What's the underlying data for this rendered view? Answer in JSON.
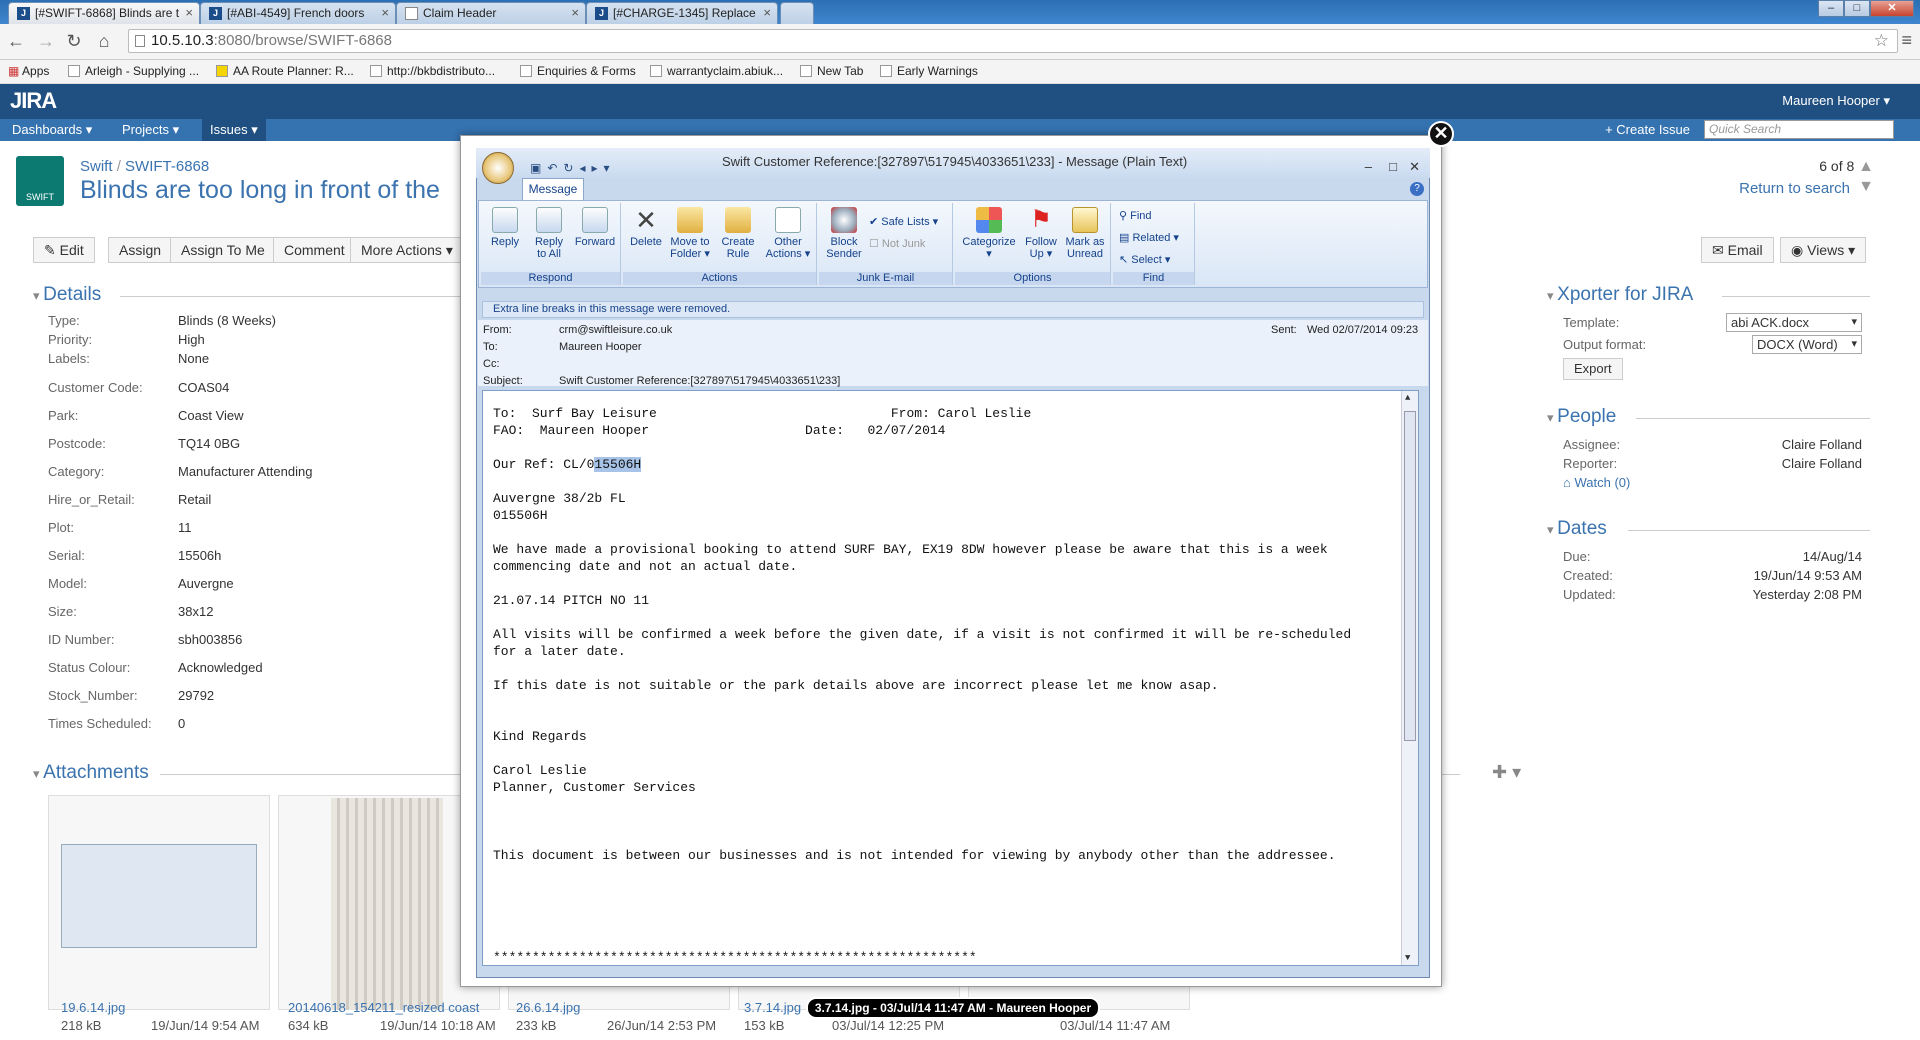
{
  "browser": {
    "tabs": [
      "[#SWIFT-6868] Blinds are t",
      "[#ABI-4549] French doors",
      "Claim Header",
      "[#CHARGE-1345] Replace"
    ],
    "url_host": "10.5.10.3",
    "url_path": ":8080/browse/SWIFT-6868",
    "bookmarks": [
      "Apps",
      "Arleigh - Supplying ...",
      "AA Route Planner: R...",
      "http://bkbdistributo...",
      "Enquiries & Forms",
      "warrantyclaim.abiuk...",
      "New Tab",
      "Early Warnings"
    ]
  },
  "jira": {
    "logo": "JIRA",
    "user": "Maureen Hooper",
    "nav": [
      "Dashboards",
      "Projects",
      "Issues"
    ],
    "create_issue": "+ Create Issue",
    "quick_search_placeholder": "Quick Search",
    "project_icon_label": "SWIFT",
    "breadcrumb_project": "Swift",
    "breadcrumb_key": "SWIFT-6868",
    "title": "Blinds are too long in front of the",
    "pager": "6 of 8",
    "return_to_search": "Return to search",
    "toolbar": [
      "Edit",
      "Assign",
      "Assign To Me",
      "Comment",
      "More Actions"
    ],
    "email": "Email",
    "views": "Views",
    "details_heading": "Details",
    "details": [
      {
        "label": "Type:",
        "value": "Blinds (8 Weeks)"
      },
      {
        "label": "Priority:",
        "value": "High"
      },
      {
        "label": "Labels:",
        "value": "None"
      },
      {
        "label": "Customer Code:",
        "value": "COAS04"
      },
      {
        "label": "Park:",
        "value": "Coast View"
      },
      {
        "label": "Postcode:",
        "value": "TQ14 0BG"
      },
      {
        "label": "Category:",
        "value": "Manufacturer Attending"
      },
      {
        "label": "Hire_or_Retail:",
        "value": "Retail"
      },
      {
        "label": "Plot:",
        "value": "11"
      },
      {
        "label": "Serial:",
        "value": "15506h"
      },
      {
        "label": "Model:",
        "value": "Auvergne"
      },
      {
        "label": "Size:",
        "value": "38x12"
      },
      {
        "label": "ID Number:",
        "value": "sbh003856"
      },
      {
        "label": "Status Colour:",
        "value": "Acknowledged"
      },
      {
        "label": "Stock_Number:",
        "value": "29792"
      },
      {
        "label": "Times Scheduled:",
        "value": "0"
      }
    ],
    "xporter": {
      "heading": "Xporter for JIRA",
      "template_label": "Template:",
      "template_value": "abi ACK.docx",
      "format_label": "Output format:",
      "format_value": "DOCX (Word)",
      "export": "Export"
    },
    "people": {
      "heading": "People",
      "assignee_label": "Assignee:",
      "assignee": "Claire Folland",
      "reporter_label": "Reporter:",
      "reporter": "Claire Folland",
      "watch": "Watch (0)"
    },
    "dates": {
      "heading": "Dates",
      "due_label": "Due:",
      "due": "14/Aug/14",
      "created_label": "Created:",
      "created": "19/Jun/14 9:53 AM",
      "updated_label": "Updated:",
      "updated": "Yesterday 2:08 PM"
    },
    "attachments_heading": "Attachments",
    "attachments": [
      {
        "name": "19.6.14.jpg",
        "size": "218 kB",
        "date": "19/Jun/14 9:54 AM"
      },
      {
        "name": "20140618_154211_resized coast",
        "size": "634 kB",
        "date": "19/Jun/14 10:18 AM"
      },
      {
        "name": "26.6.14.jpg",
        "size": "233 kB",
        "date": "26/Jun/14 2:53 PM"
      },
      {
        "name": "3.7.14.jpg",
        "size": "153 kB",
        "date": "03/Jul/14 12:25 PM"
      },
      {
        "name": "",
        "size": "",
        "date": "03/Jul/14 11:47 AM"
      }
    ],
    "tooltip": "3.7.14.jpg - 03/Jul/14 11:47 AM - Maureen Hooper"
  },
  "outlook": {
    "title": "Swift Customer Reference:[327897\\517945\\4033651\\233] - Message (Plain Text)",
    "ribbon_tab": "Message",
    "groups": {
      "respond": "Respond",
      "actions": "Actions",
      "junk": "Junk E-mail",
      "options": "Options",
      "find": "Find"
    },
    "buttons": {
      "reply": "Reply",
      "reply_all_1": "Reply",
      "reply_all_2": "to All",
      "forward": "Forward",
      "delete": "Delete",
      "move_1": "Move to",
      "move_2": "Folder",
      "create_1": "Create",
      "create_2": "Rule",
      "other_1": "Other",
      "other_2": "Actions",
      "block_1": "Block",
      "block_2": "Sender",
      "safe_lists": "Safe Lists",
      "not_junk": "Not Junk",
      "categorize": "Categorize",
      "follow_1": "Follow",
      "follow_2": "Up",
      "mark_1": "Mark as",
      "mark_2": "Unread",
      "find": "Find",
      "related": "Related",
      "select": "Select"
    },
    "infobar": "Extra line breaks in this message were removed.",
    "from_label": "From:",
    "from": "crm@swiftleisure.co.uk",
    "to_label": "To:",
    "to": "Maureen Hooper",
    "cc_label": "Cc:",
    "subject_label": "Subject:",
    "subject": "Swift Customer Reference:[327897\\517945\\4033651\\233]",
    "sent_label": "Sent:",
    "sent": "Wed 02/07/2014 09:23",
    "body_before": "To:  Surf Bay Leisure                              From: Carol Leslie\nFAO:  Maureen Hooper                    Date:   02/07/2014\n\nOur Ref: CL/0",
    "body_highlight": "15506H",
    "body_after": "\n\nAuvergne 38/2b FL\n015506H\n\nWe have made a provisional booking to attend SURF BAY, EX19 8DW however please be aware that this is a week\ncommencing date and not an actual date.\n\n21.07.14 PITCH NO 11\n\nAll visits will be confirmed a week before the given date, if a visit is not confirmed it will be re-scheduled\nfor a later date.\n\nIf this date is not suitable or the park details above are incorrect please let me know asap.\n\n\nKind Regards\n\nCarol Leslie\nPlanner, Customer Services\n\n\n\nThis document is between our businesses and is not intended for viewing by anybody other than the addressee.\n\n\n\n\n\n**************************************************************"
  }
}
